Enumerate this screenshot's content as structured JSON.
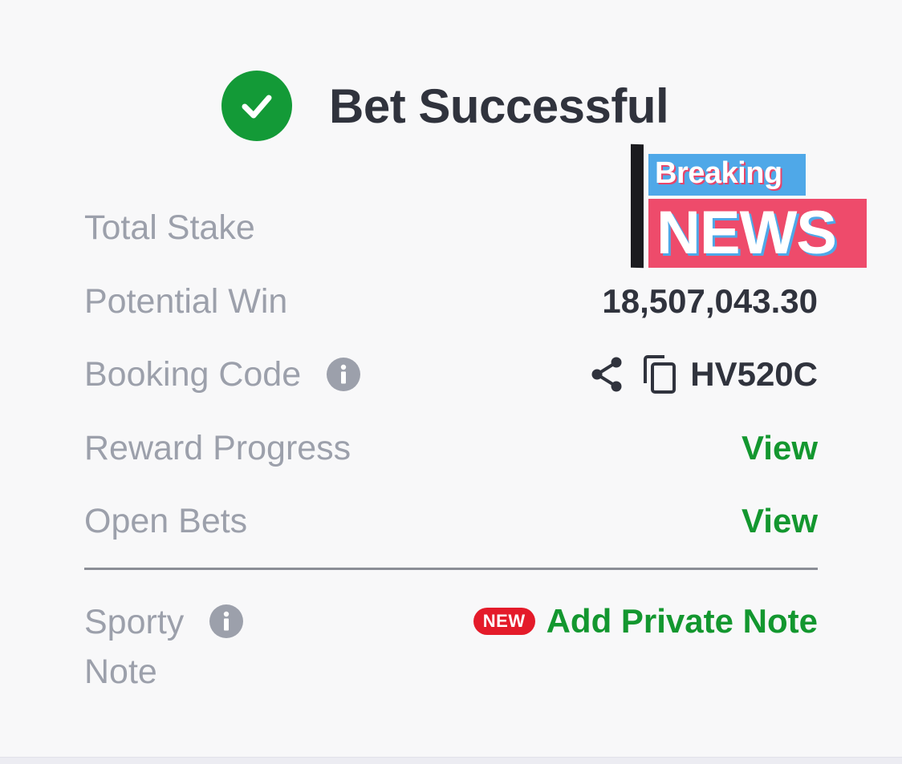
{
  "header": {
    "title": "Bet Successful",
    "status_color": "#139a37"
  },
  "overlay": {
    "breaking": "Breaking",
    "news": "NEWS"
  },
  "rows": {
    "total_stake": {
      "label": "Total Stake"
    },
    "potential_win": {
      "label": "Potential Win",
      "value": "18,507,043.30"
    },
    "booking_code": {
      "label": "Booking Code",
      "value": "HV520C"
    },
    "reward_progress": {
      "label": "Reward Progress",
      "action": "View"
    },
    "open_bets": {
      "label": "Open Bets",
      "action": "View"
    }
  },
  "note": {
    "label_line1": "Sporty",
    "label_line2": "Note",
    "badge": "NEW",
    "action": "Add Private Note"
  },
  "icons": {
    "status": "check-circle-icon",
    "info": "info-icon",
    "share": "share-icon",
    "copy": "copy-icon"
  },
  "colors": {
    "accent_green": "#13972f",
    "badge_red": "#e41b2a",
    "label_gray": "#9ca0ab",
    "text_dark": "#30333d"
  }
}
